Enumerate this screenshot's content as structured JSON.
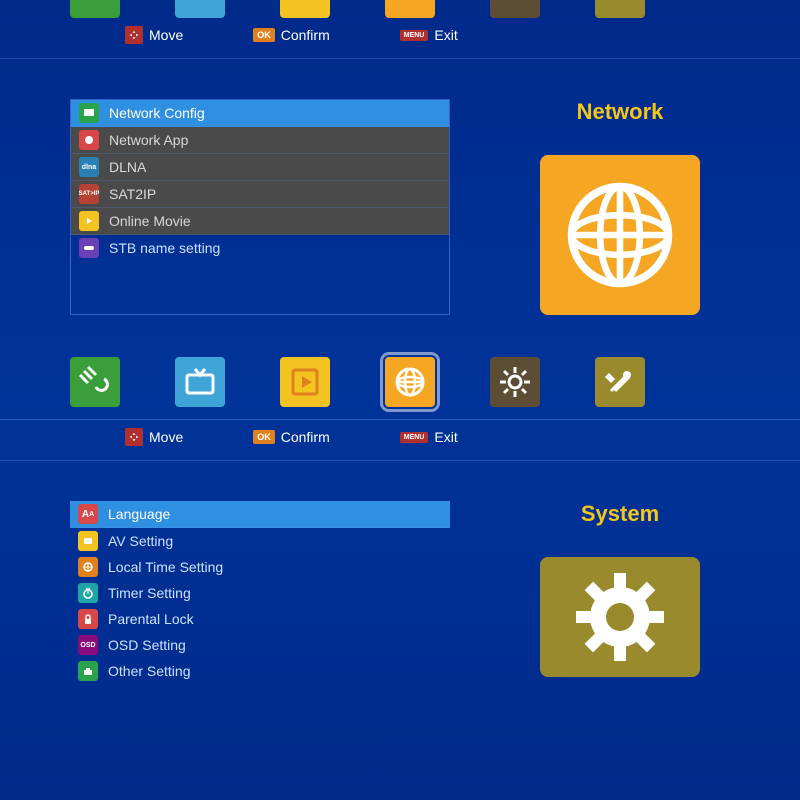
{
  "hints": {
    "move": "Move",
    "confirm": "Confirm",
    "exit": "Exit",
    "ok_badge": "OK",
    "menu_badge": "MENU"
  },
  "screen_network": {
    "title": "Network",
    "items": [
      {
        "label": "Network Config",
        "state": "selected"
      },
      {
        "label": "Network App",
        "state": "dark"
      },
      {
        "label": "DLNA",
        "state": "dark"
      },
      {
        "label": "SAT2IP",
        "state": "dark"
      },
      {
        "label": "Online Movie",
        "state": "dark"
      },
      {
        "label": "STB name setting",
        "state": "plain"
      }
    ]
  },
  "screen_system": {
    "title": "System",
    "items": [
      {
        "label": "Language",
        "state": "selected"
      },
      {
        "label": "AV Setting"
      },
      {
        "label": "Local Time Setting"
      },
      {
        "label": "Timer Setting"
      },
      {
        "label": "Parental Lock"
      },
      {
        "label": "OSD Setting"
      },
      {
        "label": "Other Setting"
      }
    ]
  },
  "nav_tiles": [
    "satellite",
    "tv",
    "media",
    "network",
    "system",
    "tools"
  ]
}
